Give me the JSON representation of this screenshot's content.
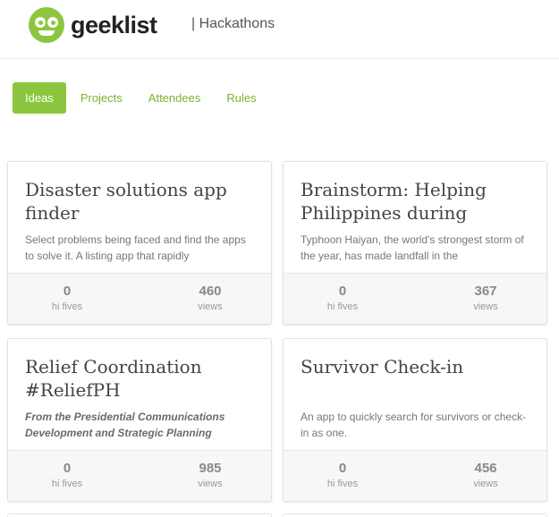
{
  "header": {
    "logo_text": "geeklist",
    "section": "|  Hackathons"
  },
  "tabs": [
    {
      "label": "Ideas",
      "active": true
    },
    {
      "label": "Projects",
      "active": false
    },
    {
      "label": "Attendees",
      "active": false
    },
    {
      "label": "Rules",
      "active": false
    }
  ],
  "cards": [
    {
      "title": "Disaster solutions app finder",
      "description": "Select problems being faced and find the apps to solve it. A listing app that rapidly",
      "hi_fives": "0",
      "hi_fives_label": "hi fives",
      "views": "460",
      "views_label": "views"
    },
    {
      "title": "Brainstorm: Helping Philippines during",
      "description": "Typhoon Haiyan, the world's strongest storm of the year, has made landfall in the",
      "hi_fives": "0",
      "hi_fives_label": "hi fives",
      "views": "367",
      "views_label": "views"
    },
    {
      "title": "Relief Coordination #ReliefPH",
      "description": "From the Presidential Communications Development and Strategic Planning",
      "hi_fives": "0",
      "hi_fives_label": "hi fives",
      "views": "985",
      "views_label": "views"
    },
    {
      "title": "Survivor Check-in",
      "description": "An app to quickly search for survivors or check-in as one.",
      "hi_fives": "0",
      "hi_fives_label": "hi fives",
      "views": "456",
      "views_label": "views"
    }
  ],
  "colors": {
    "brand_green": "#8cc63f",
    "tab_link_green": "#7ab330"
  }
}
